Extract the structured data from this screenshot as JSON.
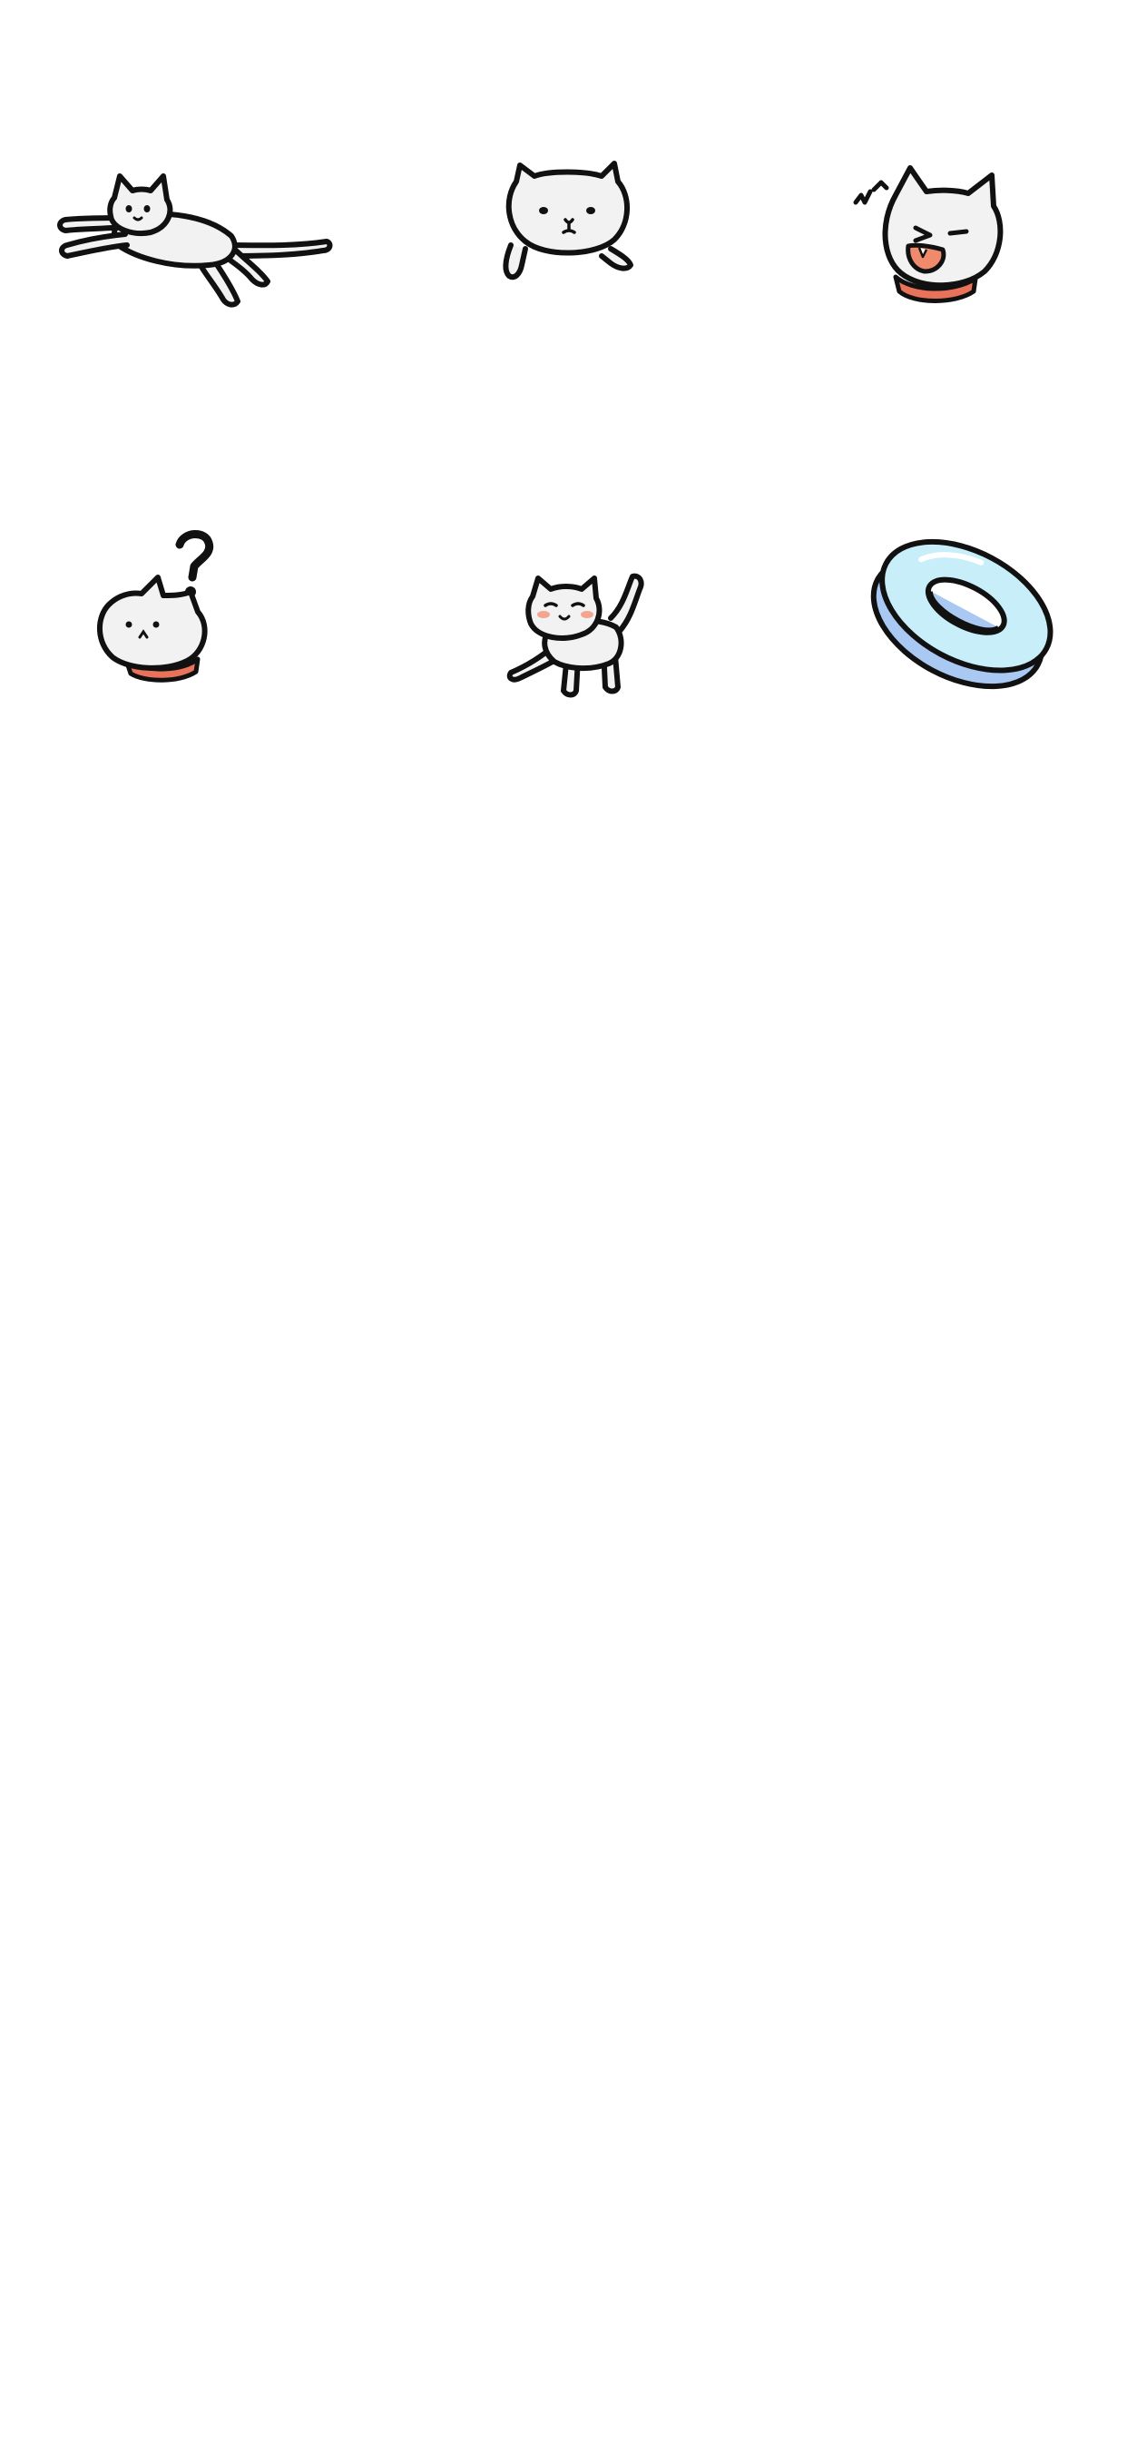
{
  "screen": {
    "background": "#ffffff"
  },
  "stickers": [
    {
      "icon": "leaping-cat-icon"
    },
    {
      "icon": "chubby-cat-face-icon"
    },
    {
      "icon": "yelling-cat-icon"
    },
    {
      "icon": "confused-cat-icon"
    },
    {
      "icon": "walking-cat-icon"
    },
    {
      "icon": "swim-ring-icon"
    }
  ],
  "palette": {
    "outline": "#111111",
    "cat_fill": "#f2f2f2",
    "collar": "#e8735a",
    "mouth": "#f08a6c",
    "blush": "#f3a58f",
    "ring_top": "#c8eefa",
    "ring_side": "#a9c8f2"
  }
}
